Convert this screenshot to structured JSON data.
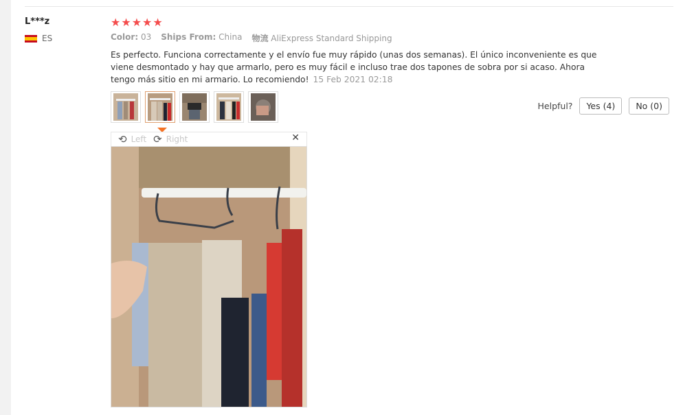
{
  "review": {
    "user": "L***z",
    "country_code": "ES",
    "stars": 5,
    "color_label": "Color:",
    "color_value": "03",
    "ships_label": "Ships From:",
    "ships_value": "China",
    "logistics_label": "物流",
    "logistics_value": "AliExpress Standard Shipping",
    "text": "Es perfecto. Funciona correctamente y el envío fue muy rápido (unas dos semanas). El único inconveniente es que viene desmontado y hay que armarlo, pero es muy fácil e incluso trae dos tapones de sobra por si acaso. Ahora tengo más sitio en mi armario. Lo recomiendo!",
    "date": "15 Feb 2021 02:18"
  },
  "helpful": {
    "label": "Helpful?",
    "yes": "Yes (4)",
    "no": "No (0)"
  },
  "viewer": {
    "rotate_left": "Left",
    "rotate_right": "Right",
    "close_icon": "close-icon"
  },
  "colors": {
    "star": "#f44c4c",
    "active_thumb_arrow": "#f57224"
  }
}
